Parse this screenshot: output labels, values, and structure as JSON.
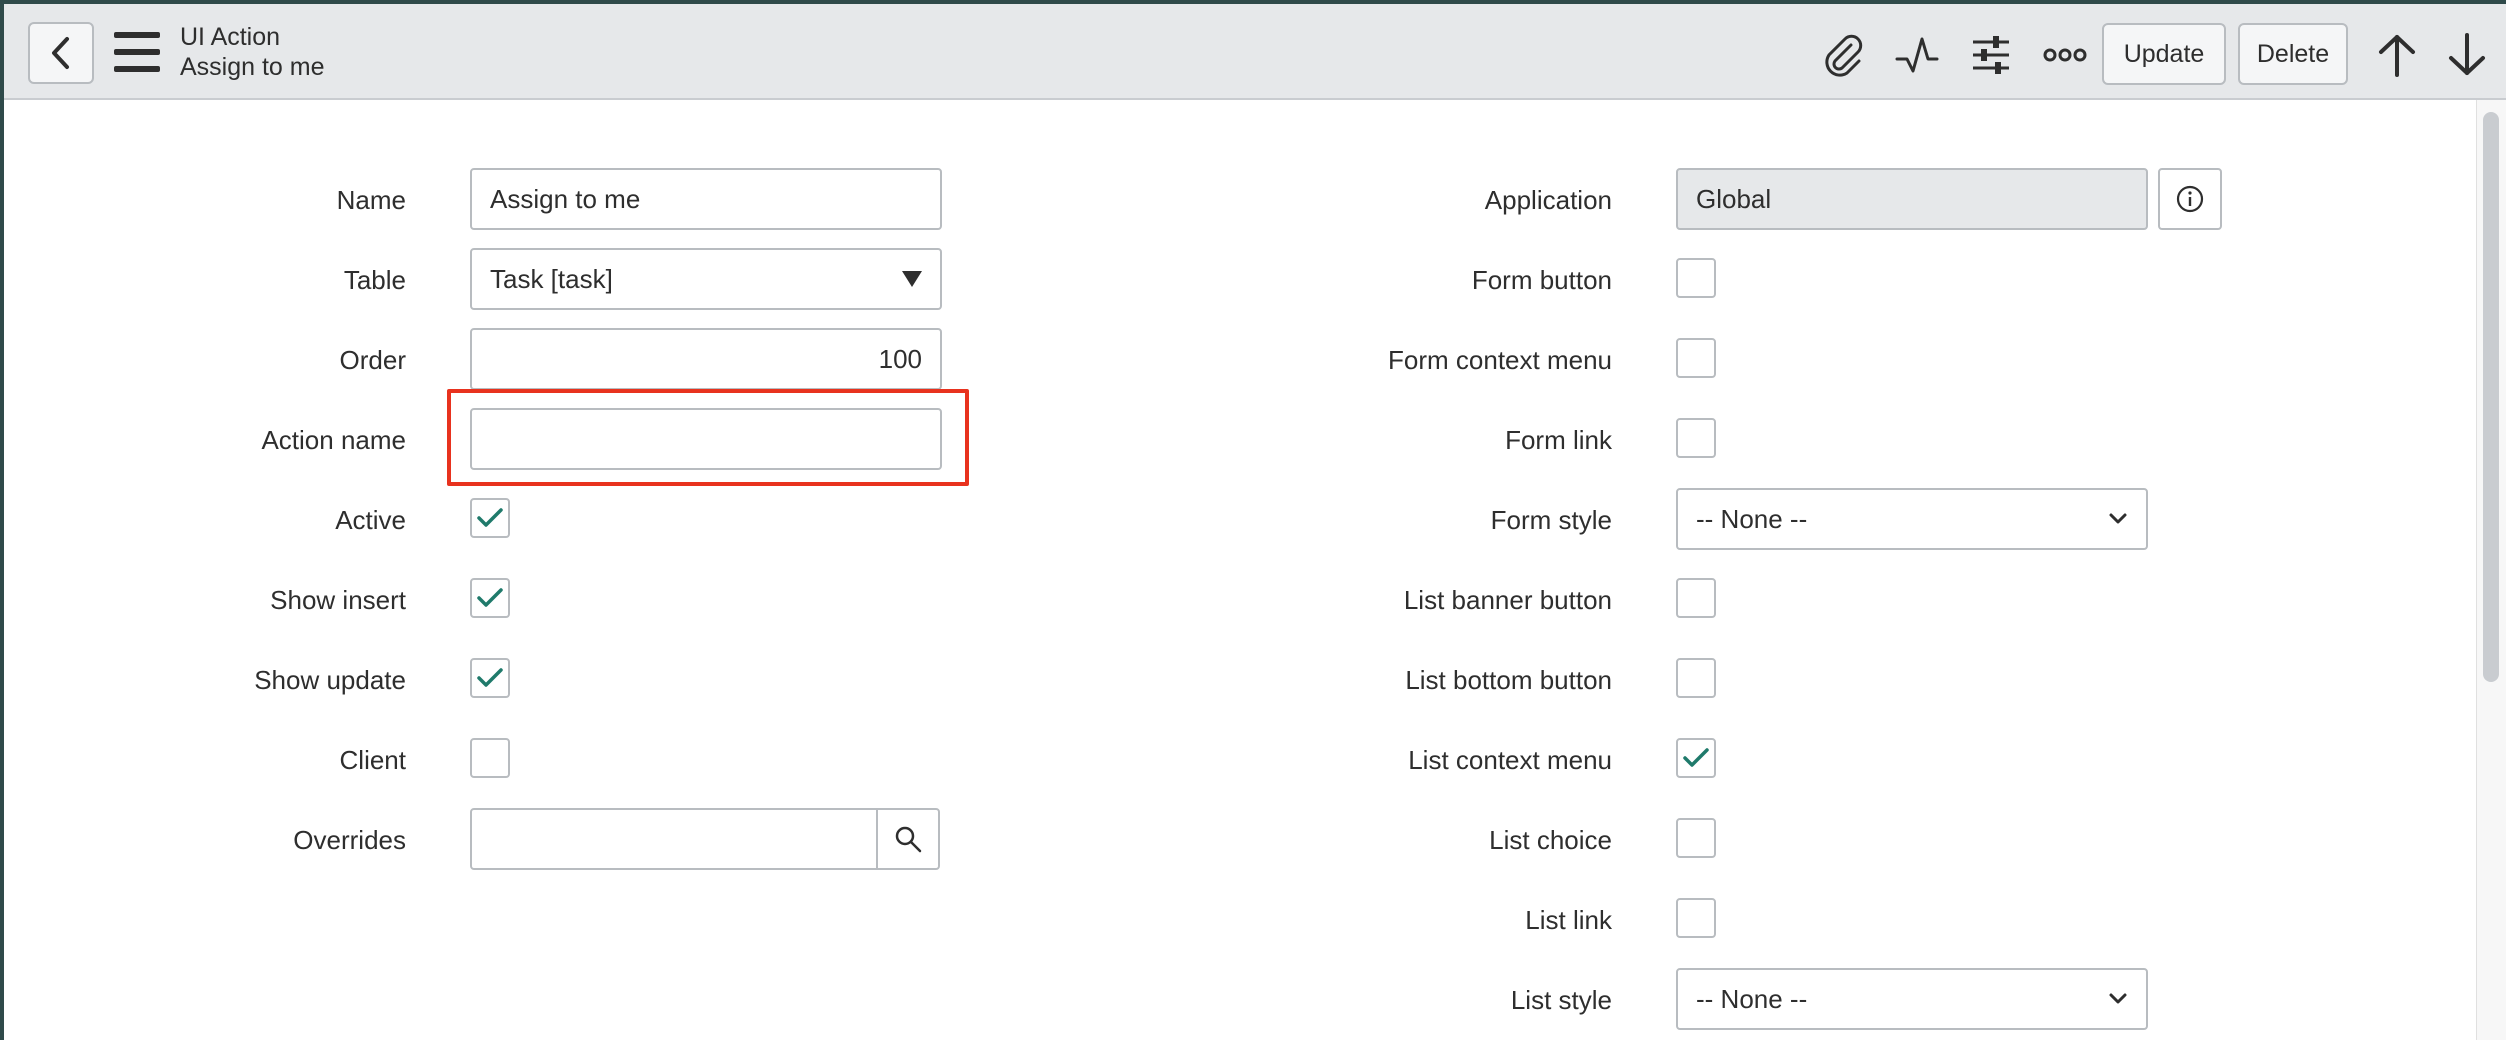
{
  "header": {
    "record_type": "UI Action",
    "record_name": "Assign to me",
    "buttons": {
      "update": "Update",
      "delete": "Delete"
    },
    "icons": [
      "chevron-left-icon",
      "hamburger-menu-icon",
      "paperclip-icon",
      "activity-icon",
      "sliders-icon",
      "more-options-icon",
      "arrow-up-icon",
      "arrow-down-icon"
    ]
  },
  "form_left": {
    "name": {
      "label": "Name",
      "value": "Assign to me"
    },
    "table": {
      "label": "Table",
      "value": "Task [task]"
    },
    "order": {
      "label": "Order",
      "value": "100"
    },
    "action_name": {
      "label": "Action name",
      "value": ""
    },
    "active": {
      "label": "Active",
      "checked": true
    },
    "show_insert": {
      "label": "Show insert",
      "checked": true
    },
    "show_update": {
      "label": "Show update",
      "checked": true
    },
    "client": {
      "label": "Client",
      "checked": false
    },
    "overrides": {
      "label": "Overrides",
      "value": ""
    }
  },
  "form_right": {
    "application": {
      "label": "Application",
      "value": "Global"
    },
    "form_button": {
      "label": "Form button",
      "checked": false
    },
    "form_context_menu": {
      "label": "Form context menu",
      "checked": false
    },
    "form_link": {
      "label": "Form link",
      "checked": false
    },
    "form_style": {
      "label": "Form style",
      "value": "-- None --"
    },
    "list_banner_button": {
      "label": "List banner button",
      "checked": false
    },
    "list_bottom_button": {
      "label": "List bottom button",
      "checked": false
    },
    "list_context_menu": {
      "label": "List context menu",
      "checked": true
    },
    "list_choice": {
      "label": "List choice",
      "checked": false
    },
    "list_link": {
      "label": "List link",
      "checked": false
    },
    "list_style": {
      "label": "List style",
      "value": "-- None --"
    }
  },
  "colors": {
    "header_bg": "#e6e8ea",
    "check": "#1f7a6b",
    "highlight": "#e8321e",
    "border": "#b8bcc0"
  }
}
